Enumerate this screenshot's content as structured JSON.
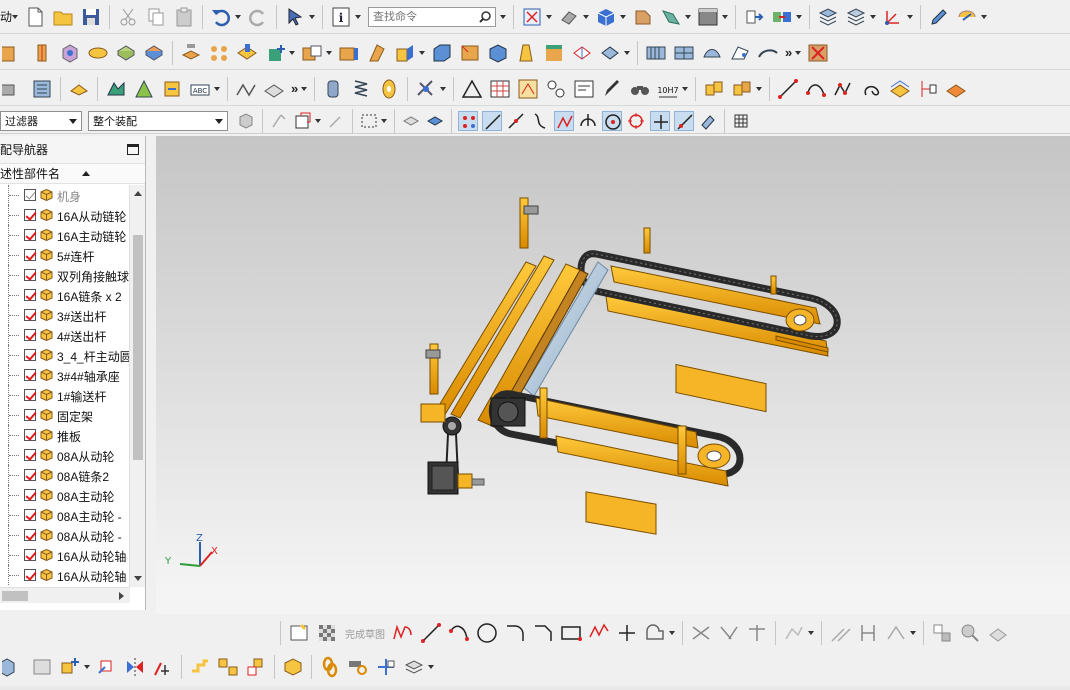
{
  "toolbar1": {
    "left_clip_text": "动",
    "search_placeholder": "查找命令"
  },
  "filter_bar": {
    "filter_label": "过滤器",
    "assembly_label": "整个装配"
  },
  "navigator": {
    "title": "配导航器",
    "column_header": "述性部件名",
    "items": [
      {
        "label": "机身",
        "checked": false
      },
      {
        "label": "16A从动链轮",
        "checked": true
      },
      {
        "label": "16A主动链轮",
        "checked": true
      },
      {
        "label": "5#连杆",
        "checked": true
      },
      {
        "label": "双列角接触球",
        "checked": true
      },
      {
        "label": "16A链条 x 2",
        "checked": true
      },
      {
        "label": "3#送出杆",
        "checked": true
      },
      {
        "label": "4#送出杆",
        "checked": true
      },
      {
        "label": "3_4_杆主动圆",
        "checked": true
      },
      {
        "label": "3#4#轴承座",
        "checked": true
      },
      {
        "label": "1#输送杆",
        "checked": true
      },
      {
        "label": "固定架",
        "checked": true
      },
      {
        "label": "推板",
        "checked": true
      },
      {
        "label": "08A从动轮",
        "checked": true
      },
      {
        "label": "08A链条2",
        "checked": true
      },
      {
        "label": "08A主动轮",
        "checked": true
      },
      {
        "label": "08A主动轮 -",
        "checked": true
      },
      {
        "label": "08A从动轮 -",
        "checked": true
      },
      {
        "label": "16A从动轮轴",
        "checked": true
      },
      {
        "label": "16A从动轮轴",
        "checked": true
      }
    ]
  },
  "sketch_toolbar": {
    "finish_sketch_label": "完成草图"
  },
  "toolbar2": {
    "tolerance_label": "10H7"
  },
  "triad": {
    "x_label": "X",
    "y_label": "Y",
    "z_label": "Z"
  },
  "colors": {
    "accent_yellow": "#f2a81d",
    "chain_dark": "#2a2a2a",
    "check_red": "#e31b1b",
    "shaft_blue": "#a8c4dc"
  }
}
